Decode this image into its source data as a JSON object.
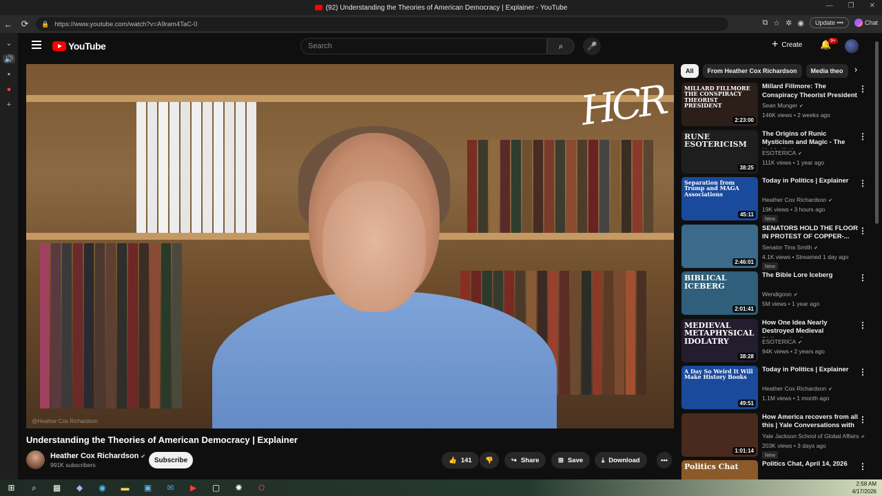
{
  "window": {
    "title": "(92) Understanding the Theories of American Democracy | Explainer - YouTube",
    "controls": [
      "—",
      "❐",
      "✕"
    ]
  },
  "browser": {
    "url": "https://www.youtube.com/watch?v=A9ram4TaC-0",
    "update_label": "Update",
    "chat_label": "Chat"
  },
  "header": {
    "logo_text": "YouTube",
    "search_placeholder": "Search",
    "create_label": "Create",
    "notif_count": "9+"
  },
  "video": {
    "overlay_logo": "HCR",
    "watermark": "@Heather Cox Richardson",
    "title": "Understanding the Theories of American Democracy | Explainer"
  },
  "channel": {
    "name": "Heather Cox Richardson",
    "subscribers": "991K subscribers",
    "subscribe_label": "Subscribe"
  },
  "actions": {
    "likes": "141",
    "share_label": "Share",
    "save_label": "Save",
    "download_label": "Download"
  },
  "chips": [
    "All",
    "From Heather Cox Richardson",
    "Media theo"
  ],
  "recommendations": [
    {
      "title": "Millard Fillmore: The Conspiracy Theorist President",
      "channel": "Sean Munger",
      "meta": "146K views • 2 weeks ago",
      "duration": "2:23:00",
      "new": "",
      "thumb_text": "MILLARD FILLMORE THE CONSPIRACY THEORIST PRESIDENT",
      "thumb_color": "#2c1f1a",
      "thumb_text_color": "#ffffff"
    },
    {
      "title": "The Origins of Runic Mysticism and Magic - The Kabbalistic ...",
      "channel": "ESOTERICA",
      "meta": "111K views • 1 year ago",
      "duration": "38:25",
      "new": "",
      "thumb_text": "RUNE ESOTERICISM",
      "thumb_color": "#1e1e1e",
      "thumb_text_color": "#eeeeee"
    },
    {
      "title": "Today in Politics | Explainer",
      "channel": "Heather Cox Richardson",
      "meta": "19K views • 3 hours ago",
      "duration": "45:11",
      "new": "New",
      "thumb_text": "Separation from Trump and MAGA Associations",
      "thumb_color": "#1a4a9c",
      "thumb_text_color": "#ffffff"
    },
    {
      "title": "SENATORS HOLD THE FLOOR IN PROTEST OF COPPER-...",
      "channel": "Senator Tina Smith",
      "meta": "4.1K views • Streamed 1 day ago",
      "duration": "2:46:01",
      "new": "New",
      "thumb_text": "",
      "thumb_color": "#3b6a8a",
      "thumb_text_color": "#ffffff"
    },
    {
      "title": "The Bible Lore Iceberg",
      "channel": "Wendigoon",
      "meta": "5M views • 1 year ago",
      "duration": "2:01:41",
      "new": "",
      "thumb_text": "BIBLICAL ICEBERG",
      "thumb_color": "#2f5f7a",
      "thumb_text_color": "#ffffff"
    },
    {
      "title": "How One Idea Nearly Destroyed Medieval Philosophy & ...",
      "channel": "ESOTERICA",
      "meta": "94K views • 2 years ago",
      "duration": "38:28",
      "new": "",
      "thumb_text": "MEDIEVAL METAPHYSICAL IDOLATRY",
      "thumb_color": "#241d2e",
      "thumb_text_color": "#ffffff"
    },
    {
      "title": "Today in Politics | Explainer",
      "channel": "Heather Cox Richardson",
      "meta": "1.1M views • 1 month ago",
      "duration": "49:51",
      "new": "",
      "thumb_text": "A Day So Weird It Will Make History Books",
      "thumb_color": "#1a4a9c",
      "thumb_text_color": "#ffffff"
    },
    {
      "title": "How America recovers from all this | Yale Conversations with ...",
      "channel": "Yale Jackson School of Global Affairs",
      "meta": "203K views • 3 days ago",
      "duration": "1:01:14",
      "new": "New",
      "thumb_text": "",
      "thumb_color": "#4a2a1e",
      "thumb_text_color": "#ffffff"
    },
    {
      "title": "Politics Chat, April 14, 2026",
      "channel": "",
      "meta": "",
      "duration": "",
      "new": "",
      "thumb_text": "Politics Chat",
      "thumb_color": "#8a5a2a",
      "thumb_text_color": "#ffffff"
    }
  ],
  "taskbar": {
    "time": "2:58 AM",
    "date": "4/17/2026"
  },
  "icons": {
    "back": "←",
    "reload": "⟳",
    "menu": "☰",
    "search": "⌕",
    "mic": "🎙",
    "bell": "🔔",
    "like": "👍",
    "dislike": "👎",
    "share": "↪",
    "save": "≡+",
    "download": "⤓",
    "more": "•••",
    "kebab": "⋮",
    "chevron": "›"
  },
  "colors": {
    "accent": "#ff0000",
    "background": "#0f0f0f",
    "pill": "#272727"
  }
}
